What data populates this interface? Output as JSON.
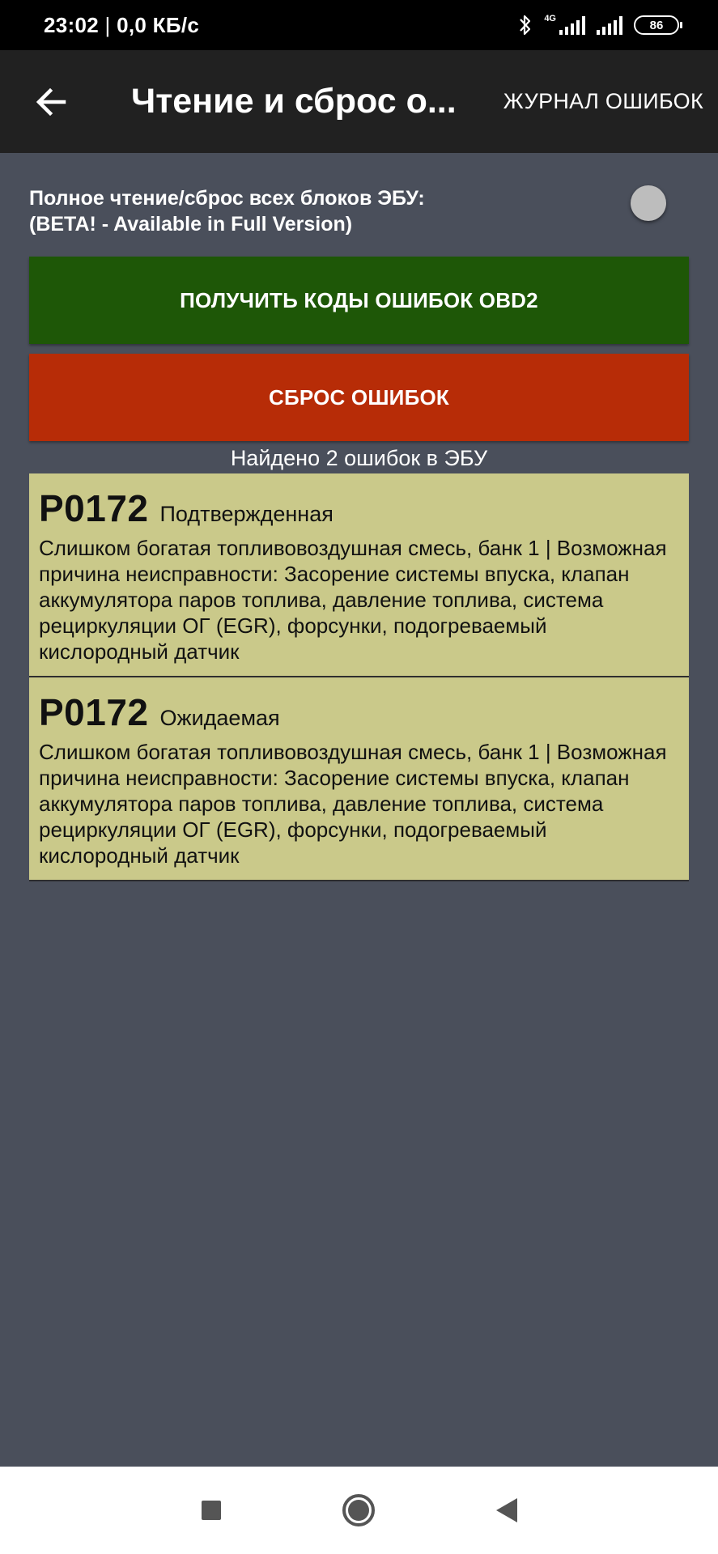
{
  "status_bar": {
    "time": "23:02",
    "separator": " | ",
    "speed": "0,0 КБ/с",
    "network": "4G",
    "battery": "86"
  },
  "app_bar": {
    "back_icon": "arrow-back-icon",
    "title": "Чтение и сброс о...",
    "log_button": "ЖУРНАЛ ОШИБОК"
  },
  "full_read": {
    "line1": "Полное чтение/сброс всех блоков ЭБУ:",
    "line2": "(BETA! - Available in Full Version)",
    "switch_on": false
  },
  "buttons": {
    "get_codes": "ПОЛУЧИТЬ КОДЫ ОШИБОК OBD2",
    "reset": "СБРОС ОШИБОК"
  },
  "found_text": "Найдено 2 ошибок в ЭБУ",
  "errors": [
    {
      "code": "P0172",
      "status": "Подтвержденная",
      "description": "Слишком богатая топливовоздушная смесь, банк 1 | Возможная причина неисправности: Засорение системы впуска, клапан аккумулятора паров топлива, давление топлива, система рециркуляции ОГ (EGR), форсунки, подогреваемый кислородный датчик"
    },
    {
      "code": "P0172",
      "status": "Ожидаемая",
      "description": "Слишком богатая топливовоздушная смесь, банк 1 | Возможная причина неисправности: Засорение системы впуска, клапан аккумулятора паров топлива, давление топлива, система рециркуляции ОГ (EGR), форсунки, подогреваемый кислородный датчик"
    }
  ],
  "nav_bar": {
    "recent_icon": "square-icon",
    "home_icon": "home-circle-icon",
    "back_icon": "triangle-back-icon"
  },
  "colors": {
    "background": "#4a4f5b",
    "app_bar": "#212121",
    "green_button": "#1e5707",
    "red_button": "#b72c07",
    "error_card": "#cac98a"
  }
}
